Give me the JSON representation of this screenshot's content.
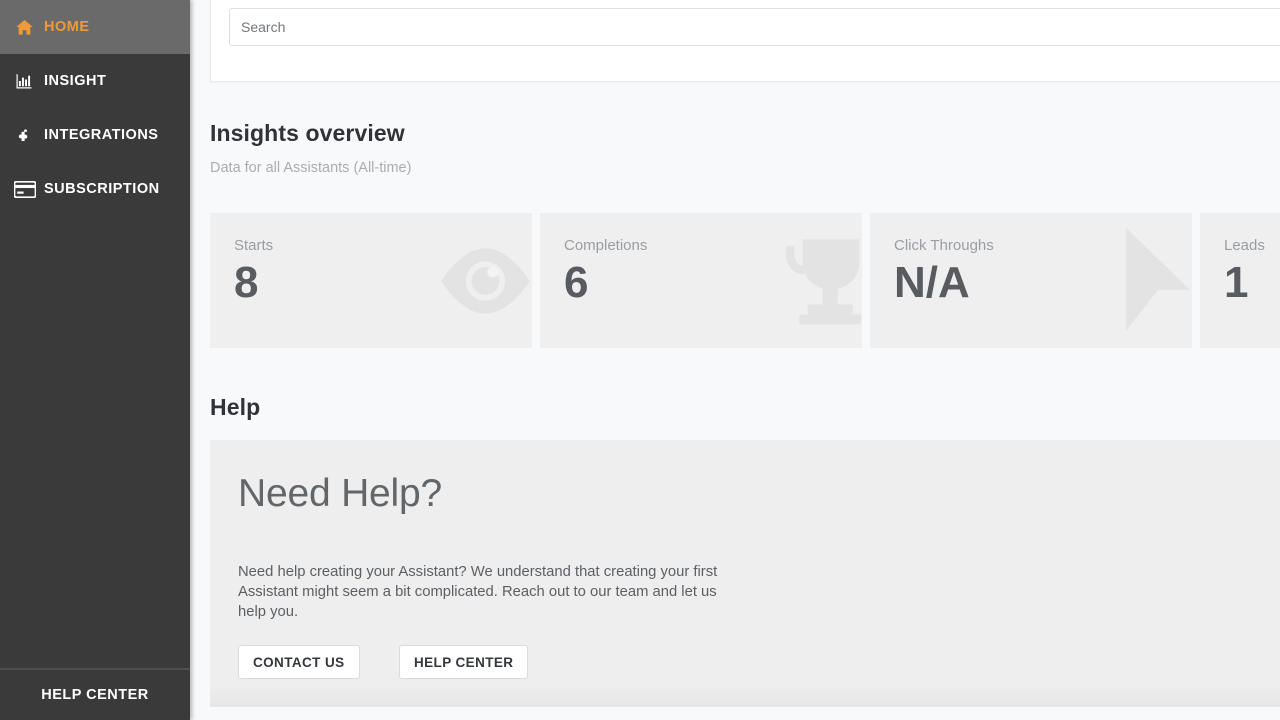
{
  "sidebar": {
    "items": [
      {
        "label": "HOME",
        "icon": "home-icon",
        "active": true
      },
      {
        "label": "INSIGHT",
        "icon": "bar-chart-icon",
        "active": false
      },
      {
        "label": "INTEGRATIONS",
        "icon": "puzzle-piece-icon",
        "active": false
      },
      {
        "label": "SUBSCRIPTION",
        "icon": "credit-card-icon",
        "active": false
      }
    ],
    "footer_label": "HELP CENTER",
    "active_color": "#ef9a3a",
    "background": "#3a3a3a",
    "active_background": "#6a6a6a"
  },
  "search": {
    "placeholder": "Search",
    "value": ""
  },
  "insights": {
    "title": "Insights overview",
    "subtitle": "Data for all Assistants (All-time)",
    "cards": [
      {
        "label": "Starts",
        "value": "8",
        "icon": "eye-icon"
      },
      {
        "label": "Completions",
        "value": "6",
        "icon": "trophy-icon"
      },
      {
        "label": "Click Throughs",
        "value": "N/A",
        "icon": "cursor-arrow-icon"
      },
      {
        "label": "Leads",
        "value": "1",
        "icon": "bookmark-icon"
      }
    ]
  },
  "help": {
    "section_title": "Help",
    "heading": "Need Help?",
    "body": "Need help creating your Assistant? We understand that creating your first Assistant might seem a bit complicated. Reach out to our team and let us help you.",
    "buttons": [
      {
        "label": "CONTACT US"
      },
      {
        "label": "HELP CENTER"
      }
    ]
  }
}
